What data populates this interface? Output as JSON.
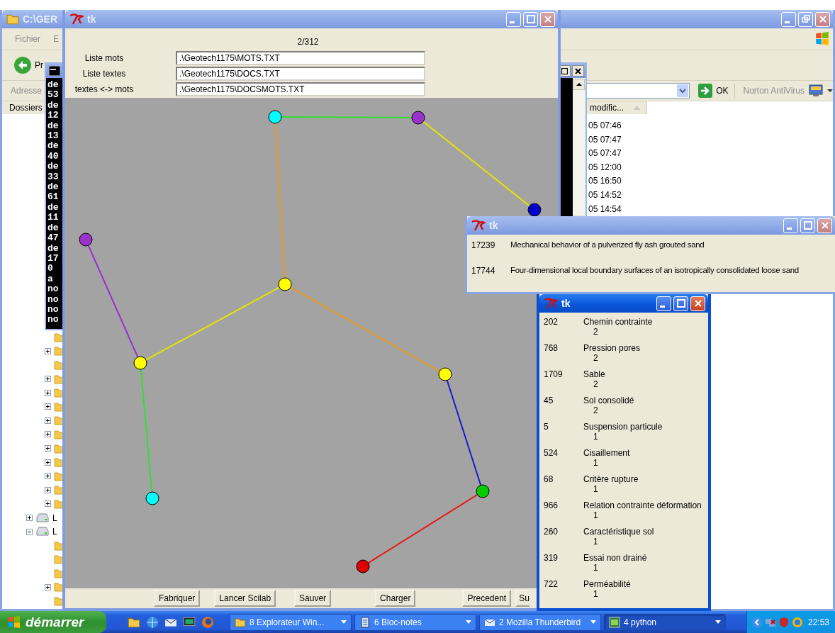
{
  "explorer": {
    "title": "C:\\GER",
    "menu": [
      "Fichier",
      "E"
    ],
    "back_label": "Pr",
    "address_label": "Adresse",
    "go_label": "OK",
    "toolbar_label": "Norton AntiVirus",
    "folders_label": "Dossiers",
    "column": "modific...",
    "dates": [
      "05 07:46",
      "05 07:47",
      "05 07:47",
      "05 12:00",
      "05 16:50",
      "05 14:52",
      "05 14:54"
    ],
    "tree": [
      {
        "kind": "folder"
      },
      {
        "kind": "branch",
        "expanded": false
      },
      {
        "kind": "folder"
      },
      {
        "kind": "branch",
        "expanded": false
      },
      {
        "kind": "branch",
        "expanded": false
      },
      {
        "kind": "branch",
        "expanded": false
      },
      {
        "kind": "branch",
        "expanded": false
      },
      {
        "kind": "branch",
        "expanded": false
      },
      {
        "kind": "branch",
        "expanded": false
      },
      {
        "kind": "branch",
        "expanded": false
      },
      {
        "kind": "branch",
        "expanded": false
      },
      {
        "kind": "branch",
        "expanded": false
      },
      {
        "kind": "branch",
        "expanded": false
      },
      {
        "kind": "drive",
        "expanded": false,
        "label": "L"
      },
      {
        "kind": "drive",
        "expanded": true,
        "label": "L",
        "children": [
          {
            "kind": "folder"
          },
          {
            "kind": "folder"
          },
          {
            "kind": "folder"
          },
          {
            "kind": "branch",
            "expanded": false
          },
          {
            "kind": "folder"
          }
        ]
      }
    ]
  },
  "console": {
    "lines": [
      "de",
      "53",
      "de",
      "12",
      "de",
      "13",
      "de",
      "40",
      "de",
      "33",
      "de",
      "61",
      "de",
      "11",
      "de",
      "47",
      "de",
      "17",
      "0",
      "a",
      "no",
      "no",
      "no",
      "no"
    ]
  },
  "main_window": {
    "title": "tk",
    "counter": "2/312",
    "fields": [
      {
        "label": "Liste mots",
        "value": ".\\Geotech1175\\MOTS.TXT"
      },
      {
        "label": "Liste textes",
        "value": ".\\Geotech1175\\DOCS.TXT"
      },
      {
        "label": "textes <-> mots",
        "value": ".\\Geotech1175\\DOCSMOTS.TXT"
      }
    ],
    "graph": {
      "nodes": [
        {
          "color": "#00ffff"
        },
        {
          "color": "#9933cc"
        },
        {
          "color": "#0000cc"
        },
        {
          "color": "#9933cc"
        },
        {
          "color": "#ffff00"
        },
        {
          "color": "#ffff00"
        },
        {
          "color": "#ffff00"
        },
        {
          "color": "#00cc00"
        },
        {
          "color": "#00ffff"
        },
        {
          "color": "#dd0000"
        }
      ],
      "edges": [
        {
          "color": "#33dd33"
        },
        {
          "color": "#e6e600"
        },
        {
          "color": "#e69a1f"
        },
        {
          "color": "#e6e600"
        },
        {
          "color": "#e69a1f"
        },
        {
          "color": "#9933cc"
        },
        {
          "color": "#33dd33"
        },
        {
          "color": "#1a1acc"
        },
        {
          "color": "#e61a1a"
        }
      ]
    },
    "buttons": [
      "Fabriquer",
      "Lancer Scilab",
      "Sauver",
      "Charger",
      "Precedent",
      "Su"
    ]
  },
  "documents_window": {
    "title": "tk",
    "rows": [
      {
        "id": "17239",
        "title": "Mechanical behavior of a pulverized fly ash grouted sand"
      },
      {
        "id": "17744",
        "title": "Four-dimensional local boundary surfaces of an isotropically consolidated loose sand"
      }
    ]
  },
  "terms_window": {
    "title": "tk",
    "rows": [
      {
        "id": "202",
        "term": "Chemin contrainte",
        "count": "2"
      },
      {
        "id": "768",
        "term": "Pression pores",
        "count": "2"
      },
      {
        "id": "1709",
        "term": "Sable",
        "count": "2"
      },
      {
        "id": "45",
        "term": "Sol consolidé",
        "count": "2"
      },
      {
        "id": "5",
        "term": "Suspension particule",
        "count": "1"
      },
      {
        "id": "524",
        "term": "Cisaillement",
        "count": "1"
      },
      {
        "id": "68",
        "term": "Critère rupture",
        "count": "1"
      },
      {
        "id": "966",
        "term": "Relation contrainte déformation",
        "count": "1"
      },
      {
        "id": "260",
        "term": "Caractéristique sol",
        "count": "1"
      },
      {
        "id": "319",
        "term": "Essai non drainé",
        "count": "1"
      },
      {
        "id": "722",
        "term": "Perméabilité",
        "count": "1"
      }
    ]
  },
  "taskbar": {
    "start": "démarrer",
    "tasks": [
      {
        "kind": "folder",
        "label": "8 Explorateur Win...",
        "selected": false
      },
      {
        "kind": "notepad",
        "label": "6 Bloc-notes",
        "selected": false
      },
      {
        "kind": "mail",
        "label": "2 Mozilla Thunderbird",
        "selected": false
      },
      {
        "kind": "python",
        "label": "4 python",
        "selected": true
      }
    ],
    "clock": "22:53"
  }
}
